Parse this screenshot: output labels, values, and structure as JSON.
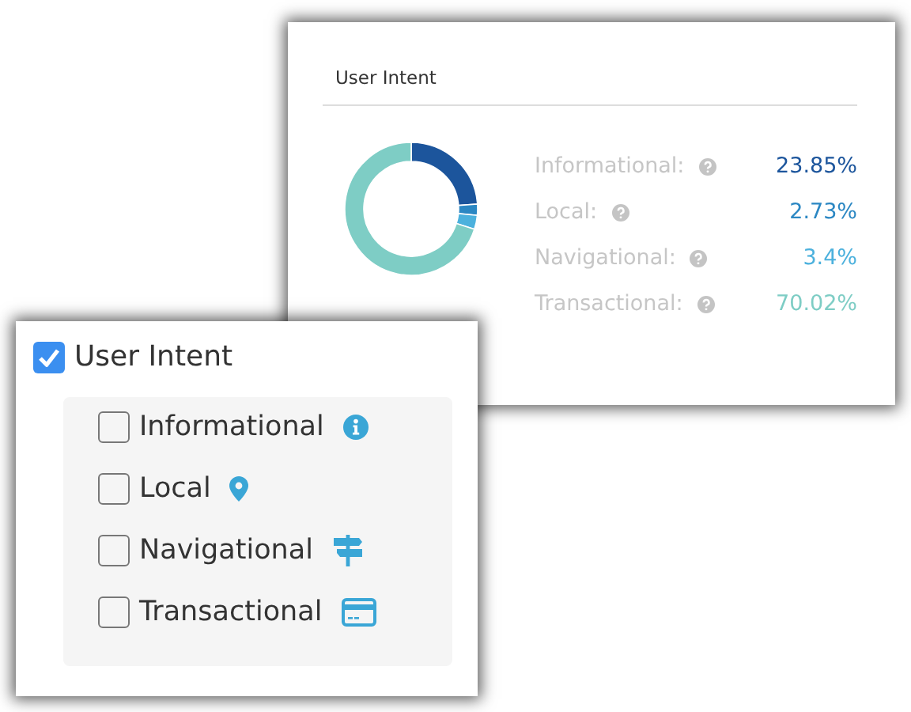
{
  "intent_card": {
    "title": "User Intent",
    "legend": [
      {
        "label": "Informational:",
        "value": "23.85%",
        "color": "#1c559c"
      },
      {
        "label": "Local:",
        "value": "2.73%",
        "color": "#2b87c3"
      },
      {
        "label": "Navigational:",
        "value": "3.4%",
        "color": "#4cb1dd"
      },
      {
        "label": "Transactional:",
        "value": "70.02%",
        "color": "#7ecdc5"
      }
    ],
    "chart_data": {
      "type": "donut",
      "values": [
        23.85,
        2.73,
        3.4,
        70.02
      ]
    }
  },
  "filter_card": {
    "label": "User Intent",
    "checked": true,
    "options": [
      {
        "label": "Informational",
        "checked": false,
        "kind": "info"
      },
      {
        "label": "Local",
        "checked": false,
        "kind": "pin"
      },
      {
        "label": "Navigational",
        "checked": false,
        "kind": "signpost"
      },
      {
        "label": "Transactional",
        "checked": false,
        "kind": "card"
      }
    ]
  }
}
